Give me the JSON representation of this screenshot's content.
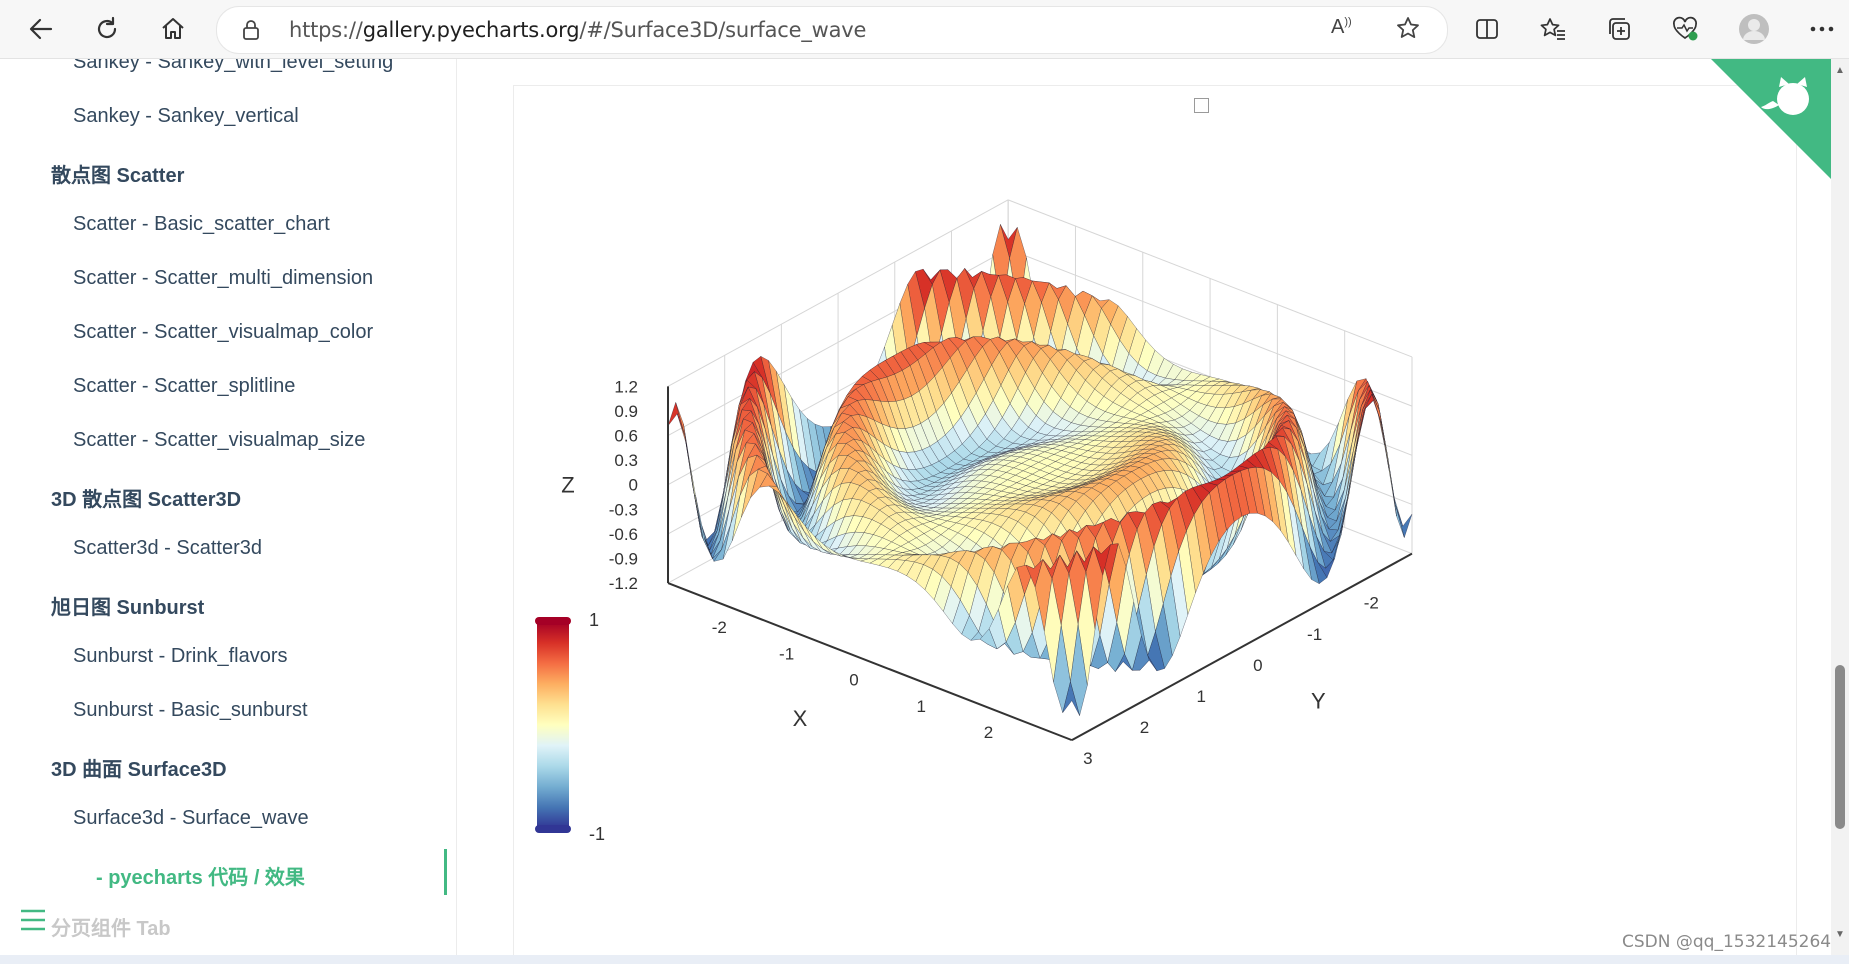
{
  "browser": {
    "url_scheme": "https://",
    "url_host": "gallery.pyecharts.org",
    "url_path": "/#/Surface3D/surface_wave",
    "read_aloud_label": "A"
  },
  "sidebar": {
    "items": [
      {
        "type": "item",
        "label": "Sankey - Sankey_with_level_setting"
      },
      {
        "type": "item",
        "label": "Sankey - Sankey_vertical"
      },
      {
        "type": "group",
        "label": "散点图 Scatter"
      },
      {
        "type": "item",
        "label": "Scatter - Basic_scatter_chart"
      },
      {
        "type": "item",
        "label": "Scatter - Scatter_multi_dimension"
      },
      {
        "type": "item",
        "label": "Scatter - Scatter_visualmap_color"
      },
      {
        "type": "item",
        "label": "Scatter - Scatter_splitline"
      },
      {
        "type": "item",
        "label": "Scatter - Scatter_visualmap_size"
      },
      {
        "type": "group",
        "label": "3D 散点图 Scatter3D"
      },
      {
        "type": "item",
        "label": "Scatter3d - Scatter3d"
      },
      {
        "type": "group",
        "label": "旭日图 Sunburst"
      },
      {
        "type": "item",
        "label": "Sunburst - Drink_flavors"
      },
      {
        "type": "item",
        "label": "Sunburst - Basic_sunburst"
      },
      {
        "type": "group",
        "label": "3D 曲面 Surface3D"
      },
      {
        "type": "item",
        "label": "Surface3d - Surface_wave"
      },
      {
        "type": "active",
        "label": "- pyecharts 代码 / 效果"
      }
    ],
    "next_group": "分页组件 Tab"
  },
  "watermark": "CSDN @qq_1532145264",
  "colors": {
    "accent": "#42b983",
    "sidebar_text": "#34495e",
    "visualmap": [
      "#313695",
      "#4575b4",
      "#74add1",
      "#abd9e9",
      "#e0f3f8",
      "#ffffbf",
      "#fee090",
      "#fdae61",
      "#f46d43",
      "#d73027",
      "#a50026"
    ]
  },
  "chart_data": {
    "type": "surface3d",
    "function": "sin(x*x + y*y) * x / 3.14",
    "x_range": [
      -3,
      3
    ],
    "y_range": [
      -3,
      3
    ],
    "z_range": [
      -1.2,
      1.2
    ],
    "x_axis_name": "X",
    "y_axis_name": "Y",
    "z_axis_name": "Z",
    "x_ticks": [
      "-2",
      "-1",
      "0",
      "1",
      "2"
    ],
    "y_ticks": [
      "-2",
      "-1",
      "0",
      "1",
      "2",
      "3"
    ],
    "z_ticks": [
      "1.2",
      "0.9",
      "0.6",
      "0.3",
      "0",
      "-0.3",
      "-0.6",
      "-0.9",
      "-1.2"
    ],
    "visualmap": {
      "min": -1,
      "max": 1,
      "max_label": "1",
      "min_label": "-1",
      "position": "left"
    }
  }
}
